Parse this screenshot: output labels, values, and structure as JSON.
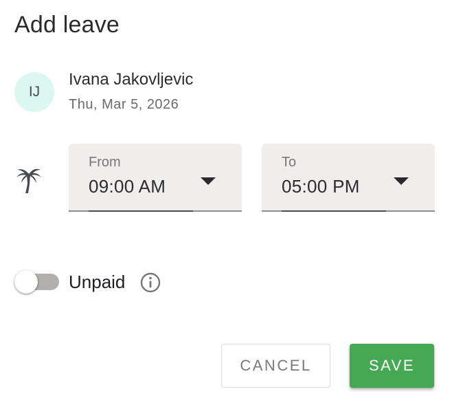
{
  "dialog": {
    "title": "Add leave"
  },
  "user": {
    "initials": "IJ",
    "name": "Ivana Jakovljevic",
    "date": "Thu, Mar 5, 2026",
    "avatar_color": "#dcf7ef"
  },
  "leave": {
    "icon": "palm-tree-icon",
    "from": {
      "label": "From",
      "value": "09:00 AM"
    },
    "to": {
      "label": "To",
      "value": "05:00 PM"
    }
  },
  "unpaid": {
    "label": "Unpaid",
    "enabled": false,
    "info_icon": "info-icon"
  },
  "actions": {
    "cancel_label": "CANCEL",
    "save_label": "SAVE",
    "save_color": "#45a853"
  }
}
